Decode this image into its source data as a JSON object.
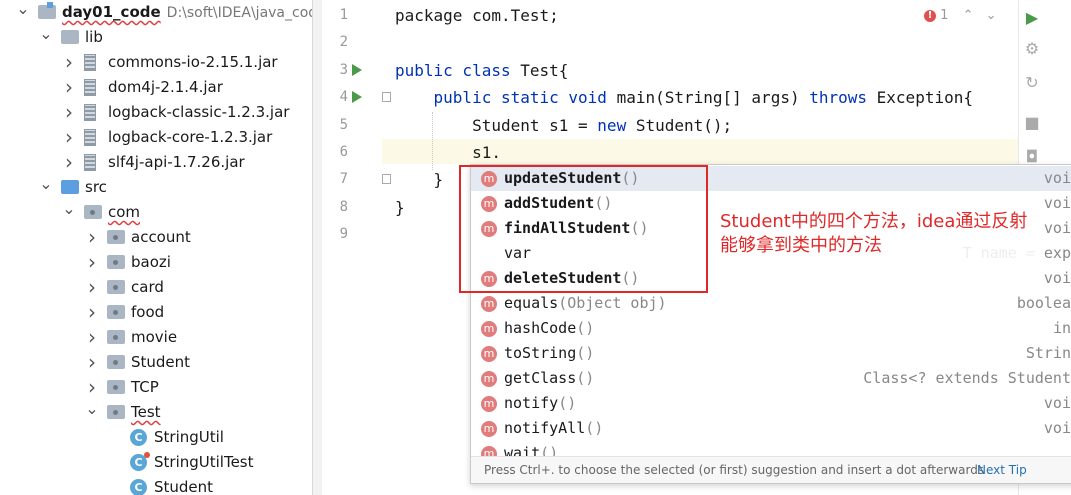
{
  "project_tree": [
    {
      "label": "day01_code",
      "path": "D:\\soft\\IDEA\\java_code",
      "icon": "module-folder-icon",
      "expanded": true,
      "indent": 0,
      "bold": true,
      "squiggle": true
    },
    {
      "label": "lib",
      "icon": "folder-icon",
      "expanded": true,
      "indent": 1
    },
    {
      "label": "commons-io-2.15.1.jar",
      "icon": "jar-icon",
      "expanded": false,
      "indent": 2
    },
    {
      "label": "dom4j-2.1.4.jar",
      "icon": "jar-icon",
      "expanded": false,
      "indent": 2
    },
    {
      "label": "logback-classic-1.2.3.jar",
      "icon": "jar-icon",
      "expanded": false,
      "indent": 2
    },
    {
      "label": "logback-core-1.2.3.jar",
      "icon": "jar-icon",
      "expanded": false,
      "indent": 2
    },
    {
      "label": "slf4j-api-1.7.26.jar",
      "icon": "jar-icon",
      "expanded": false,
      "indent": 2
    },
    {
      "label": "src",
      "icon": "source-folder-icon",
      "expanded": true,
      "indent": 1
    },
    {
      "label": "com",
      "icon": "package-icon",
      "expanded": true,
      "indent": 2,
      "squiggle": true
    },
    {
      "label": "account",
      "icon": "package-icon",
      "expanded": false,
      "indent": 3
    },
    {
      "label": "baozi",
      "icon": "package-icon",
      "expanded": false,
      "indent": 3
    },
    {
      "label": "card",
      "icon": "package-icon",
      "expanded": false,
      "indent": 3
    },
    {
      "label": "food",
      "icon": "package-icon",
      "expanded": false,
      "indent": 3
    },
    {
      "label": "movie",
      "icon": "package-icon",
      "expanded": false,
      "indent": 3
    },
    {
      "label": "Student",
      "icon": "package-icon",
      "expanded": false,
      "indent": 3
    },
    {
      "label": "TCP",
      "icon": "package-icon",
      "expanded": false,
      "indent": 3
    },
    {
      "label": "Test",
      "icon": "package-icon",
      "expanded": true,
      "indent": 3,
      "squiggle": true
    },
    {
      "label": "StringUtil",
      "icon": "class-icon",
      "indent": 4
    },
    {
      "label": "StringUtilTest",
      "icon": "class-icon",
      "indent": 4,
      "badge": true
    },
    {
      "label": "Student",
      "icon": "class-icon",
      "indent": 4
    }
  ],
  "editor": {
    "line_numbers": [
      "1",
      "2",
      "3",
      "4",
      "5",
      "6",
      "7",
      "8",
      "9"
    ],
    "lines": [
      [
        {
          "t": "package ",
          "k": false
        },
        {
          "t": "com.Test;",
          "k": false
        }
      ],
      [],
      [
        {
          "t": "public class ",
          "k": true
        },
        {
          "t": "Test{",
          "k": false
        }
      ],
      [
        {
          "t": "    ",
          "k": false
        },
        {
          "t": "public static void ",
          "k": true
        },
        {
          "t": "main(String[] args) ",
          "k": false
        },
        {
          "t": "throws ",
          "k": true
        },
        {
          "t": "Exception{",
          "k": false
        }
      ],
      [
        {
          "t": "        Student s1 = ",
          "k": false
        },
        {
          "t": "new ",
          "k": true
        },
        {
          "t": "Student();",
          "k": false
        }
      ],
      [
        {
          "t": "        s1.",
          "k": false
        }
      ],
      [
        {
          "t": "    }",
          "k": false
        }
      ],
      [
        {
          "t": "}",
          "k": false
        }
      ],
      []
    ],
    "warning_count": "1"
  },
  "completion": {
    "items": [
      {
        "icon": "m",
        "name": "updateStudent",
        "params": "()",
        "type": "voi",
        "bold": true,
        "selected": true
      },
      {
        "icon": "m",
        "name": "addStudent",
        "params": "()",
        "type": "voi",
        "bold": true
      },
      {
        "icon": "m",
        "name": "findAllStudent",
        "params": "()",
        "type": "voi",
        "bold": true
      },
      {
        "icon": "",
        "name": "var",
        "params": "",
        "type": "T name = exp",
        "bold": false
      },
      {
        "icon": "m",
        "name": "deleteStudent",
        "params": "()",
        "type": "voi",
        "bold": true
      },
      {
        "icon": "m",
        "name": "equals",
        "params": "(Object obj)",
        "type": "boolea",
        "bold": false
      },
      {
        "icon": "m",
        "name": "hashCode",
        "params": "()",
        "type": "in",
        "bold": false
      },
      {
        "icon": "m",
        "name": "toString",
        "params": "()",
        "type": "Strin",
        "bold": false
      },
      {
        "icon": "m",
        "name": "getClass",
        "params": "()",
        "type": "Class<? extends Student",
        "bold": false
      },
      {
        "icon": "m",
        "name": "notify",
        "params": "()",
        "type": "voi",
        "bold": false
      },
      {
        "icon": "m",
        "name": "notifyAll",
        "params": "()",
        "type": "voi",
        "bold": false
      },
      {
        "icon": "m",
        "name": "wait",
        "params": "()",
        "type": "",
        "bold": false
      }
    ],
    "footer_text": "Press Ctrl+. to choose the selected (or first) suggestion and insert a dot afterwards",
    "footer_link": "Next Tip"
  },
  "annotation": {
    "text": "Student中的四个方法，idea通过反射能够拿到类中的方法"
  },
  "colors": {
    "annotation_red": "#e02828",
    "keyword_blue": "#0033b3",
    "method_icon": "#e17c7c",
    "run_green": "#4a9a4a"
  }
}
